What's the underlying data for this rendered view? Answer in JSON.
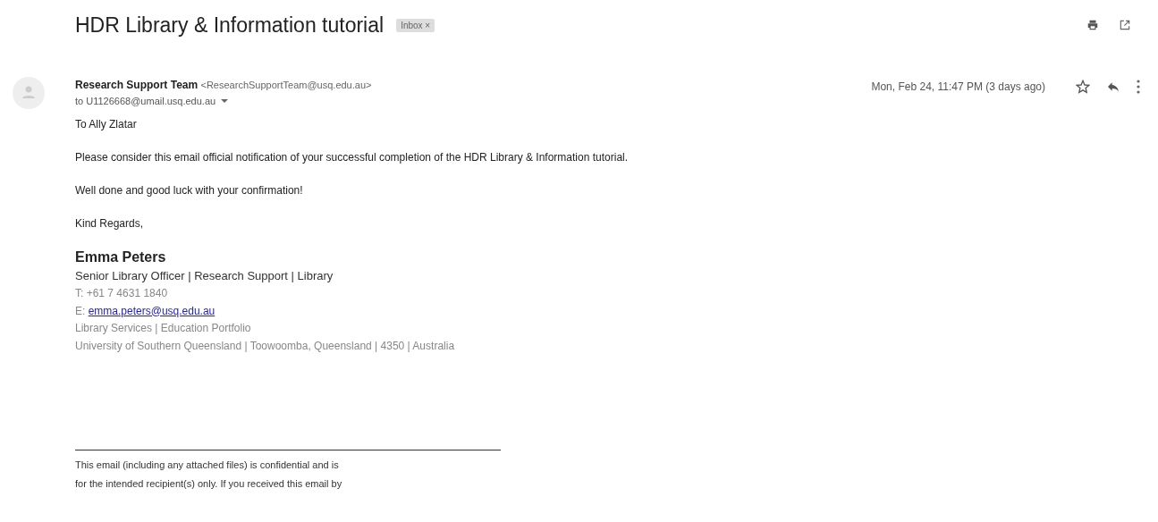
{
  "subject": "HDR Library & Information tutorial",
  "label": {
    "text": "Inbox",
    "close": "×"
  },
  "sender": {
    "name": "Research Support Team",
    "email": "<ResearchSupportTeam@usq.edu.au>",
    "to": "to U1126668@umail.usq.edu.au",
    "date": "Mon, Feb 24, 11:47 PM (3 days ago)",
    "starred": false
  },
  "body": [
    "To Ally Zlatar",
    "Please consider this email official notification of your successful completion of the HDR Library & Information tutorial.",
    "Well done and good luck with your confirmation!",
    "Kind Regards,"
  ],
  "signature": {
    "name": "Emma Peters",
    "role": "Senior Library Officer | Research Support | Library",
    "phone": "T: +61 7 4631 1840",
    "email_prefix": "E: ",
    "email": "emma.peters@usq.edu.au",
    "unit": "Library Services | Education Portfolio",
    "address": "University of Southern Queensland | Toowoomba, Queensland | 4350 | Australia"
  },
  "disclaimer": [
    "This email (including any attached files) is confidential and is",
    "for the intended recipient(s) only. If you received this email by"
  ]
}
